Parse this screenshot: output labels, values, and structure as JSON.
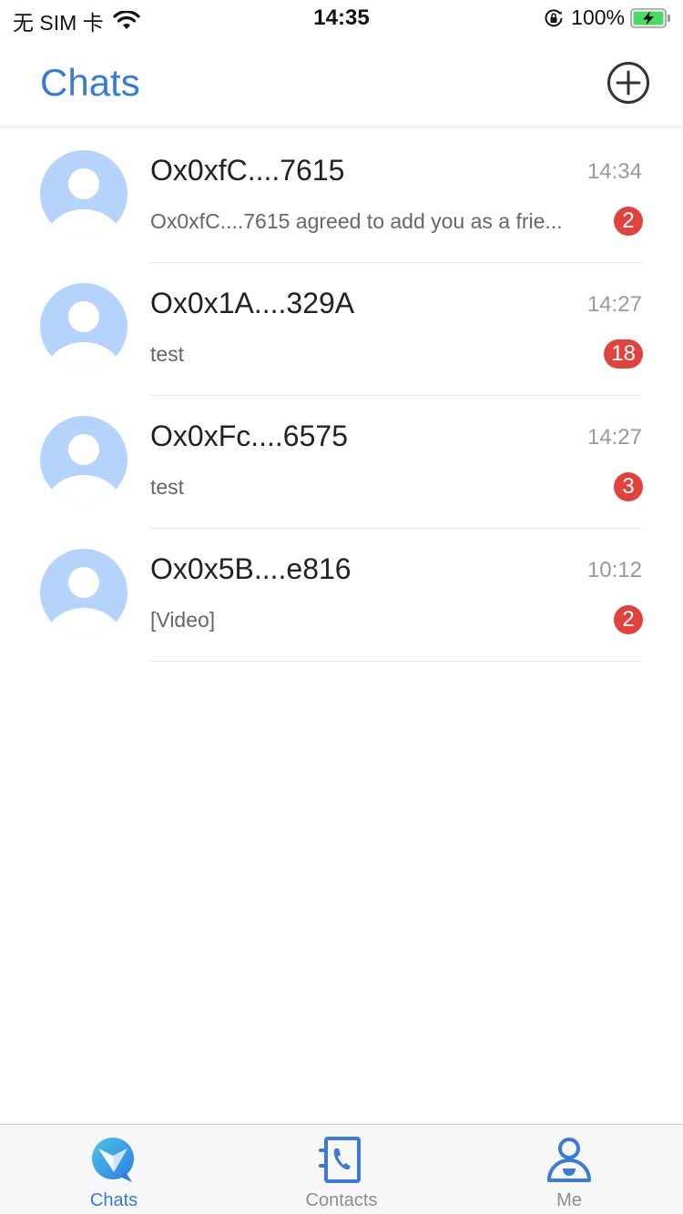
{
  "status_bar": {
    "carrier": "无 SIM 卡",
    "time": "14:35",
    "battery_percent": "100%"
  },
  "header": {
    "title": "Chats",
    "add_icon": "plus-circle-icon"
  },
  "colors": {
    "accent": "#3a7bd5",
    "badge": "#e0433d",
    "avatar": "#b5d3fb",
    "battery": "#4cd964"
  },
  "chats": [
    {
      "name": "Ox0xfC....7615",
      "time": "14:34",
      "preview": "Ox0xfC....7615 agreed to add you as a frie...",
      "unread": "2"
    },
    {
      "name": "Ox0x1A....329A",
      "time": "14:27",
      "preview": "test",
      "unread": "18"
    },
    {
      "name": "Ox0xFc....6575",
      "time": "14:27",
      "preview": "test",
      "unread": "3"
    },
    {
      "name": "Ox0x5B....e816",
      "time": "10:12",
      "preview": "[Video]",
      "unread": "2"
    }
  ],
  "tabs": [
    {
      "label": "Chats",
      "icon": "chat-bubble-icon",
      "active": true
    },
    {
      "label": "Contacts",
      "icon": "contacts-book-icon",
      "active": false
    },
    {
      "label": "Me",
      "icon": "person-icon",
      "active": false
    }
  ]
}
